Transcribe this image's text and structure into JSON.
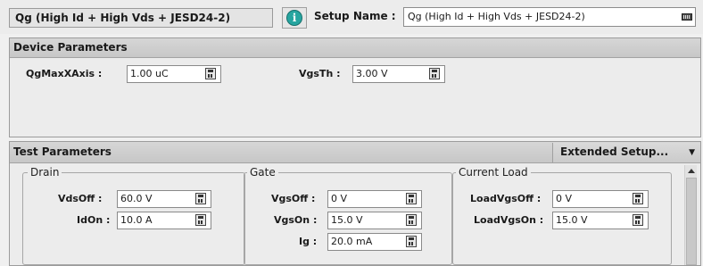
{
  "topbar": {
    "test_name": "Qg (High Id + High Vds + JESD24-2)",
    "info_icon": "i",
    "setup_label": "Setup Name :",
    "setup_value": "Qg (High Id + High Vds + JESD24-2)"
  },
  "device": {
    "header": "Device Parameters",
    "qgmax_label": "QgMaxXAxis :",
    "qgmax_value": "1.00 uC",
    "vgsth_label": "VgsTh :",
    "vgsth_value": "3.00 V"
  },
  "test": {
    "header": "Test Parameters",
    "extended_label": "Extended Setup...",
    "extended_arrow": "▼",
    "drain": {
      "legend": "Drain",
      "vdsoff_label": "VdsOff :",
      "vdsoff_value": "60.0 V",
      "idon_label": "IdOn :",
      "idon_value": "10.0 A"
    },
    "gate": {
      "legend": "Gate",
      "vgsoff_label": "VgsOff :",
      "vgsoff_value": "0 V",
      "vgson_label": "VgsOn :",
      "vgson_value": "15.0 V",
      "ig_label": "Ig :",
      "ig_value": "20.0 mA"
    },
    "load": {
      "legend": "Current Load",
      "loadvgsoff_label": "LoadVgsOff :",
      "loadvgsoff_value": "0 V",
      "loadvgson_label": "LoadVgsOn :",
      "loadvgson_value": "15.0 V"
    }
  },
  "icons": {
    "info": "info-icon",
    "keyboard": "keyboard-icon",
    "calculator": "calculator-icon",
    "dropdown": "chevron-down-icon",
    "scroll_up": "scroll-up-arrow-icon"
  },
  "colors": {
    "info_accent": "#26a5a0",
    "header_bg": "#d0d0d0",
    "panel_bg": "#ececec"
  }
}
